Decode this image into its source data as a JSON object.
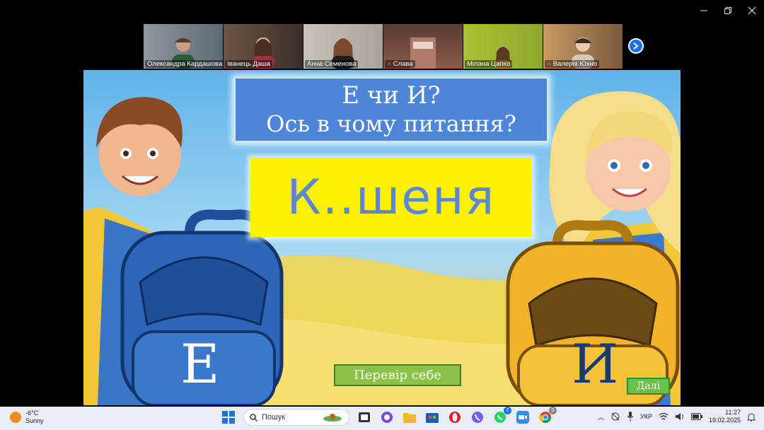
{
  "window": {
    "controls": [
      "minimize",
      "restore",
      "close"
    ]
  },
  "participants": [
    {
      "name": "Олександра Кардашова",
      "muted": false,
      "active": false
    },
    {
      "name": "Іванець Даша",
      "muted": false,
      "active": false
    },
    {
      "name": "Анна Семенова",
      "muted": false,
      "active": true
    },
    {
      "name": "Слава",
      "muted": true,
      "active": false
    },
    {
      "name": "Мілана Цапко",
      "muted": false,
      "active": false
    },
    {
      "name": "Валерія Юхно",
      "muted": true,
      "active": false
    }
  ],
  "slide": {
    "title_line1": "Е чи И?",
    "title_line2": "Ось в чому питання?",
    "word": "К..шеня",
    "letter_left": "Е",
    "letter_right": "И",
    "check_button": "Перевір себе",
    "next_button": "Далі"
  },
  "taskbar": {
    "weather_temp": "-6°C",
    "weather_desc": "Sunny",
    "search_label": "Пошук",
    "whatsapp_badge": "2",
    "chrome_badge": "0",
    "language": "УКР",
    "time": "11:27",
    "date": "19.02.2025"
  },
  "colors": {
    "active_outline": "#2bd46a",
    "title_bg": "#4d86d8",
    "word_bg": "#fff200",
    "word_text": "#5b87d4",
    "check_bg": "#8bc34a"
  }
}
